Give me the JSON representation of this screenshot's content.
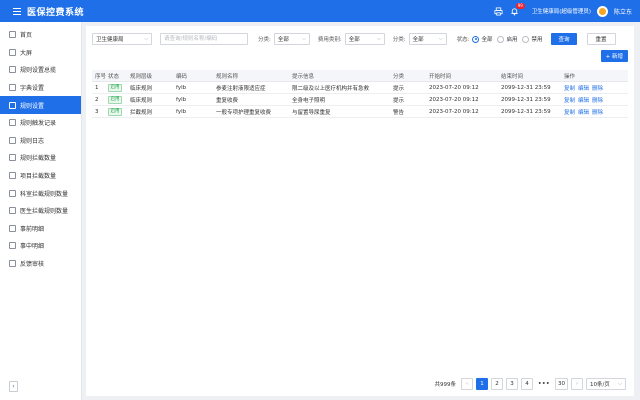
{
  "app": {
    "title": "医保控费系统",
    "user_role": "卫生健康局(超级管理员)",
    "user_name": "陈立东",
    "notification_count": "99"
  },
  "sidebar": {
    "items": [
      {
        "label": "首页",
        "icon": "user-icon",
        "active": false
      },
      {
        "label": "大屏",
        "icon": "monitor-icon",
        "active": false
      },
      {
        "label": "规则设置总揽",
        "icon": "document-icon",
        "active": false
      },
      {
        "label": "字典设置",
        "icon": "dictionary-icon",
        "active": false
      },
      {
        "label": "规则设置",
        "icon": "settings-icon",
        "active": true
      },
      {
        "label": "规则触发记录",
        "icon": "record-icon",
        "active": false
      },
      {
        "label": "规则日志",
        "icon": "log-icon",
        "active": false
      },
      {
        "label": "规则拦截数量",
        "icon": "chart-icon",
        "active": false
      },
      {
        "label": "项目拦截数量",
        "icon": "chart-icon",
        "active": false
      },
      {
        "label": "科室拦截规则数量",
        "icon": "chart-icon",
        "active": false
      },
      {
        "label": "医生拦截规则数量",
        "icon": "doctor-icon",
        "active": false
      },
      {
        "label": "事前明细",
        "icon": "folder-icon",
        "active": false
      },
      {
        "label": "事中明细",
        "icon": "list-icon",
        "active": false
      },
      {
        "label": "反馈审核",
        "icon": "feedback-icon",
        "active": false
      }
    ],
    "collapse_icon": "chevron-left-icon"
  },
  "filters": {
    "org_select": "卫生健康局",
    "search_placeholder": "请查询/规则名称/编码",
    "category_label": "分类:",
    "category_value": "全部",
    "fee_type_label": "费用类别:",
    "fee_type_value": "全部",
    "category2_label": "分类:",
    "category2_value": "全部",
    "status_label": "状态:",
    "status_options": [
      {
        "label": "全部",
        "checked": true
      },
      {
        "label": "启用",
        "checked": false
      },
      {
        "label": "禁用",
        "checked": false
      }
    ],
    "search_button": "查询",
    "reset_button": "重置"
  },
  "add_button": "+ 新增",
  "table": {
    "columns": [
      "序号",
      "状态",
      "规则层级",
      "编码",
      "规则名称",
      "提示信息",
      "分类",
      "开始时间",
      "结束时间",
      "操作"
    ],
    "rows": [
      {
        "index": "1",
        "status": "启用",
        "level": "临床规则",
        "code": "fylb",
        "name": "参麦注射液限适应症",
        "message": "限二级及以上医疗机构并有急救",
        "category": "提示",
        "start": "2023-07-20 09:12",
        "end": "2099-12-31 23:59",
        "ops": [
          "复制",
          "编辑",
          "删除"
        ]
      },
      {
        "index": "2",
        "status": "启用",
        "level": "临床规则",
        "code": "fylb",
        "name": "重复收费",
        "message": "全身电子照明",
        "category": "提示",
        "start": "2023-07-20 09:12",
        "end": "2099-12-31 23:59",
        "ops": [
          "复制",
          "编辑",
          "删除"
        ]
      },
      {
        "index": "3",
        "status": "启用",
        "level": "拦截规则",
        "code": "fylb",
        "name": "一般专项护理重复收费",
        "message": "与留置导尿重复",
        "category": "警告",
        "start": "2023-07-20 09:12",
        "end": "2099-12-31 23:59",
        "ops": [
          "复制",
          "编辑",
          "删除"
        ]
      }
    ]
  },
  "pagination": {
    "total": "共999条",
    "pages": [
      "1",
      "2",
      "3",
      "4"
    ],
    "current": "1",
    "ellipsis": "•••",
    "last": "30",
    "page_size": "10条/页",
    "prev": "‹",
    "next": "›"
  },
  "colors": {
    "primary": "#1f6fe8",
    "status_enabled": "#1ea34a"
  }
}
